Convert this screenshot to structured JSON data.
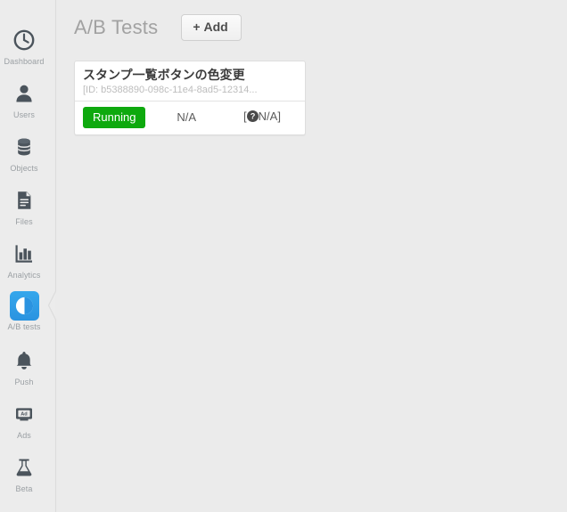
{
  "colors": {
    "app_background": "#ebebeb",
    "sidebar_background": "#ececec",
    "accent_blue": "#2a93e0",
    "status_green": "#0ea90e",
    "muted_text": "#9a9fa3"
  },
  "sidebar": {
    "items": [
      {
        "label": "Dashboard",
        "icon": "clock-icon",
        "active": false
      },
      {
        "label": "Users",
        "icon": "user-icon",
        "active": false
      },
      {
        "label": "Objects",
        "icon": "database-icon",
        "active": false
      },
      {
        "label": "Files",
        "icon": "document-icon",
        "active": false
      },
      {
        "label": "Analytics",
        "icon": "bar-chart-icon",
        "active": false
      },
      {
        "label": "A/B tests",
        "icon": "contrast-circle-icon",
        "active": true
      },
      {
        "label": "Push",
        "icon": "bell-icon",
        "active": false
      },
      {
        "label": "Ads",
        "icon": "ad-banner-icon",
        "active": false
      },
      {
        "label": "Beta",
        "icon": "flask-icon",
        "active": false
      }
    ]
  },
  "header": {
    "title": "A/B Tests",
    "add_button_plus": "+",
    "add_button_label": "Add"
  },
  "tests": [
    {
      "title": "スタンプ一覧ボタンの色変更",
      "id_text": "[ID: b5388890-098c-11e4-8ad5-12314...",
      "status": "Running",
      "metric": "N/A",
      "confidence_open": "[",
      "confidence_value": "N/A]"
    }
  ]
}
